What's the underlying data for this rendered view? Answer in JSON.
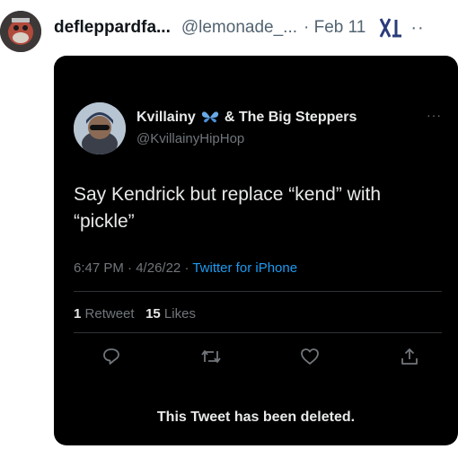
{
  "outer": {
    "display_name": "defleppardfa...",
    "handle": "@lemonade_...",
    "date": "· Feb 11",
    "more": "··"
  },
  "tweet": {
    "display_name": "Kvillainy",
    "name_suffix": "& The Big Steppers",
    "handle": "@KvillainyHipHop",
    "more": "···",
    "text": "Say Kendrick but replace “kend” with “pickle”",
    "time": "6:47 PM",
    "date": "4/26/22",
    "source": "Twitter for iPhone",
    "retweets_count": "1",
    "retweets_label": "Retweet",
    "likes_count": "15",
    "likes_label": "Likes",
    "deleted_notice": "This Tweet has been deleted."
  },
  "icons": {
    "outer_logo": "x-logo-icon",
    "name_badge": "butterfly-icon",
    "actions": [
      "reply-icon",
      "retweet-icon",
      "like-icon",
      "share-icon"
    ]
  },
  "colors": {
    "link_blue": "#1d9bf0",
    "dark_bg": "#000000",
    "butterfly_blue": "#6aa9e6"
  }
}
